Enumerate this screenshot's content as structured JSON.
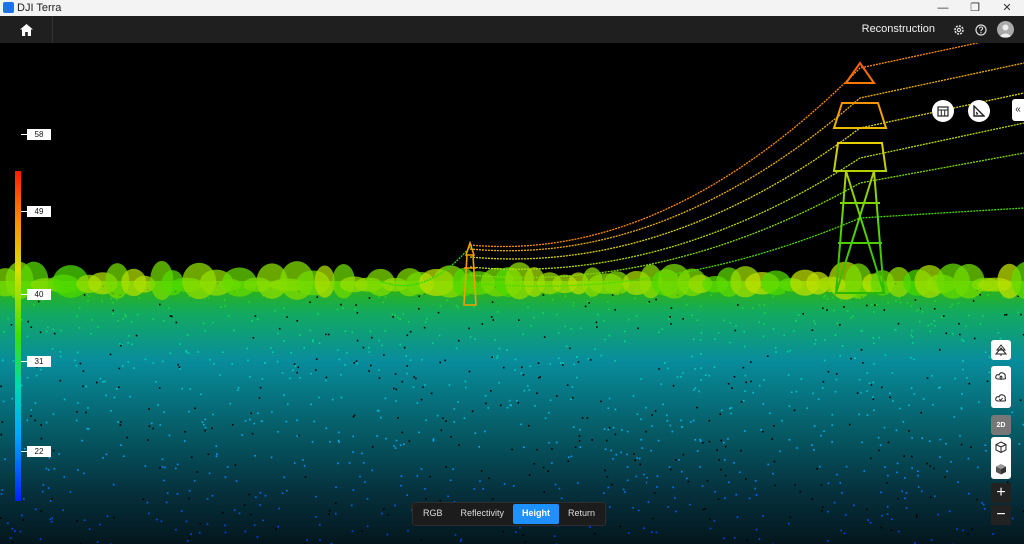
{
  "window": {
    "title": "DJI Terra"
  },
  "appbar": {
    "mode_label": "Reconstruction"
  },
  "legend": {
    "ticks": [
      "58",
      "49",
      "40",
      "31",
      "22"
    ]
  },
  "color_modes": [
    {
      "label": "RGB",
      "active": false
    },
    {
      "label": "Reflectivity",
      "active": false
    },
    {
      "label": "Height",
      "active": true
    },
    {
      "label": "Return",
      "active": false
    }
  ],
  "colors": {
    "accent": "#1e90ff",
    "titlebar": "#f3f3f3",
    "appbar": "#1f1f1f",
    "viewport": "#000000"
  }
}
